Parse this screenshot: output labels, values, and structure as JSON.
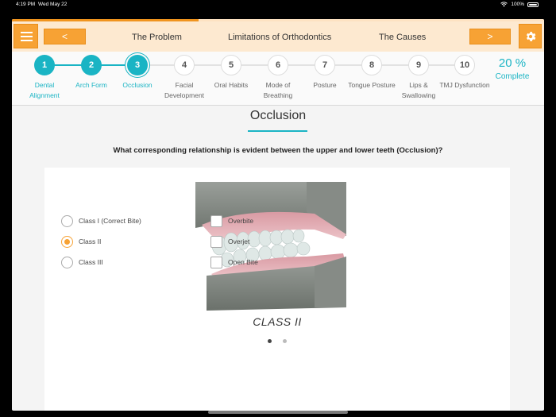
{
  "status_bar": {
    "time": "4:19 PM",
    "date": "Wed May 22",
    "battery": "100%"
  },
  "colors": {
    "accent": "#f7a234",
    "teal": "#1ab4c4",
    "header_bg": "#fde9d0"
  },
  "header": {
    "prev_label": "<",
    "next_label": ">",
    "links": [
      "The Problem",
      "Limitations of Orthodontics",
      "The Causes"
    ],
    "menu_icon": "hamburger-menu-icon",
    "settings_icon": "gear-icon"
  },
  "progress": {
    "fraction": 0.35
  },
  "steps": [
    {
      "number": "1",
      "label": "Dental Alignment",
      "state": "done"
    },
    {
      "number": "2",
      "label": "Arch Form",
      "state": "done"
    },
    {
      "number": "3",
      "label": "Occlusion",
      "state": "current"
    },
    {
      "number": "4",
      "label": "Facial Development",
      "state": "todo"
    },
    {
      "number": "5",
      "label": "Oral Habits",
      "state": "todo"
    },
    {
      "number": "6",
      "label": "Mode of Breathing",
      "state": "todo"
    },
    {
      "number": "7",
      "label": "Posture",
      "state": "todo"
    },
    {
      "number": "8",
      "label": "Tongue Posture",
      "state": "todo"
    },
    {
      "number": "9",
      "label": "Lips & Swallowing",
      "state": "todo"
    },
    {
      "number": "10",
      "label": "TMJ Dysfunction",
      "state": "todo"
    }
  ],
  "completion": {
    "value": "20 %",
    "label": "Complete"
  },
  "section": {
    "title": "Occlusion",
    "question": "What corresponding relationship is evident between the upper and lower teeth (Occlusion)?"
  },
  "illustration": {
    "caption": "CLASS II",
    "pages": 2,
    "current_page": 1
  },
  "radio_options": [
    {
      "label": "Class I (Correct Bite)",
      "checked": false
    },
    {
      "label": "Class II",
      "checked": true
    },
    {
      "label": "Class III",
      "checked": false
    }
  ],
  "checkbox_options": [
    {
      "label": "Overbite",
      "checked": false
    },
    {
      "label": "Overjet",
      "checked": false
    },
    {
      "label": "Open Bite",
      "checked": false
    }
  ]
}
